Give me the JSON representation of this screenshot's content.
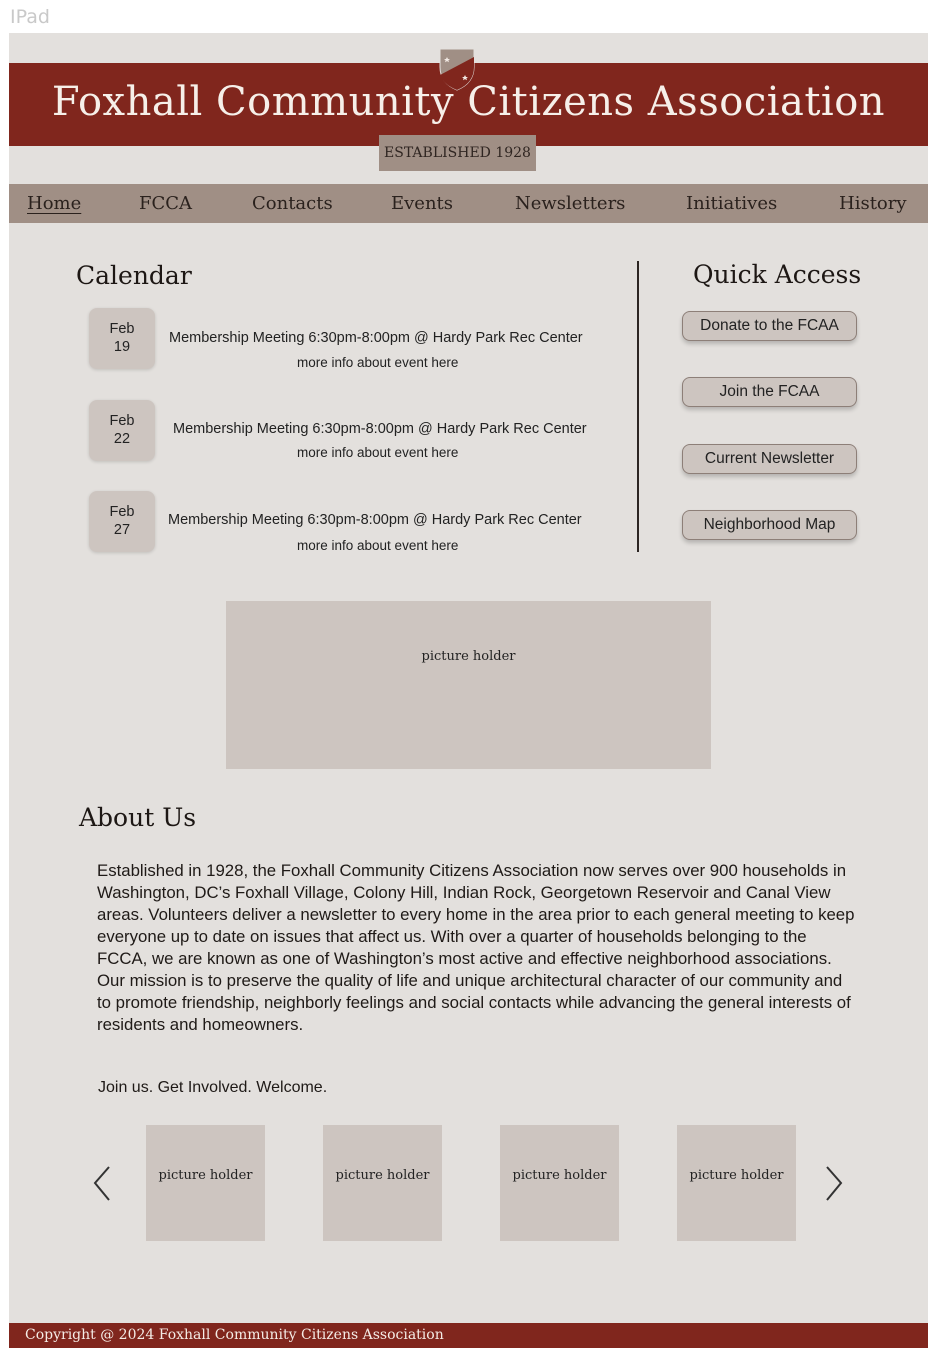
{
  "frame": {
    "label": "IPad"
  },
  "header": {
    "title": "Foxhall Community Citizens Association",
    "established": "ESTABLISHED 1928"
  },
  "nav": {
    "items": [
      {
        "label": "Home",
        "active": true
      },
      {
        "label": "FCCA"
      },
      {
        "label": "Contacts"
      },
      {
        "label": "Events"
      },
      {
        "label": "Newsletters"
      },
      {
        "label": "Initiatives"
      },
      {
        "label": "History"
      }
    ]
  },
  "calendar": {
    "title": "Calendar",
    "events": [
      {
        "month": "Feb",
        "day": "19",
        "title": "Membership Meeting 6:30pm-8:00pm @ Hardy Park Rec Center",
        "more": "more info about event here"
      },
      {
        "month": "Feb",
        "day": "22",
        "title": "Membership Meeting 6:30pm-8:00pm @ Hardy Park Rec Center",
        "more": "more info about event here"
      },
      {
        "month": "Feb",
        "day": "27",
        "title": "Membership Meeting 6:30pm-8:00pm @ Hardy Park Rec Center",
        "more": "more info about event here"
      }
    ]
  },
  "quick_access": {
    "title": "Quick Access",
    "buttons": [
      "Donate to the FCAA",
      "Join the FCAA",
      "Current Newsletter",
      "Neighborhood Map"
    ]
  },
  "main_picture": {
    "label": "picture holder"
  },
  "about": {
    "title": "About Us",
    "body": "Established in 1928, the Foxhall Community Citizens Association now serves over 900 households in Washington, DC’s Foxhall Village, Colony Hill, Indian Rock, Georgetown Reservoir and Canal View areas. Volunteers deliver a newsletter to every home in the area prior to each general meeting to keep everyone up to date on issues that affect us. With over a quarter of households belonging to the FCCA, we are known as one of Washington’s most active and effective neighborhood associations. Our mission is to preserve the quality of life and unique architectural character of our community and to promote friendship, neighborly feelings and social contacts while advancing the general interests of residents and homeowners.",
    "join": "Join us. Get Involved. Welcome."
  },
  "carousel": {
    "items": [
      "picture holder",
      "picture holder",
      "picture holder",
      "picture holder"
    ],
    "prev_icon": "chevron-left-icon",
    "next_icon": "chevron-right-icon"
  },
  "footer": {
    "text": "Copyright @ 2024 Foxhall Community Citizens Association"
  },
  "colors": {
    "brand": "#80261d",
    "nav_bg": "#a08f85",
    "page_bg": "#e3e0dd",
    "tile": "#cdc5c0"
  }
}
